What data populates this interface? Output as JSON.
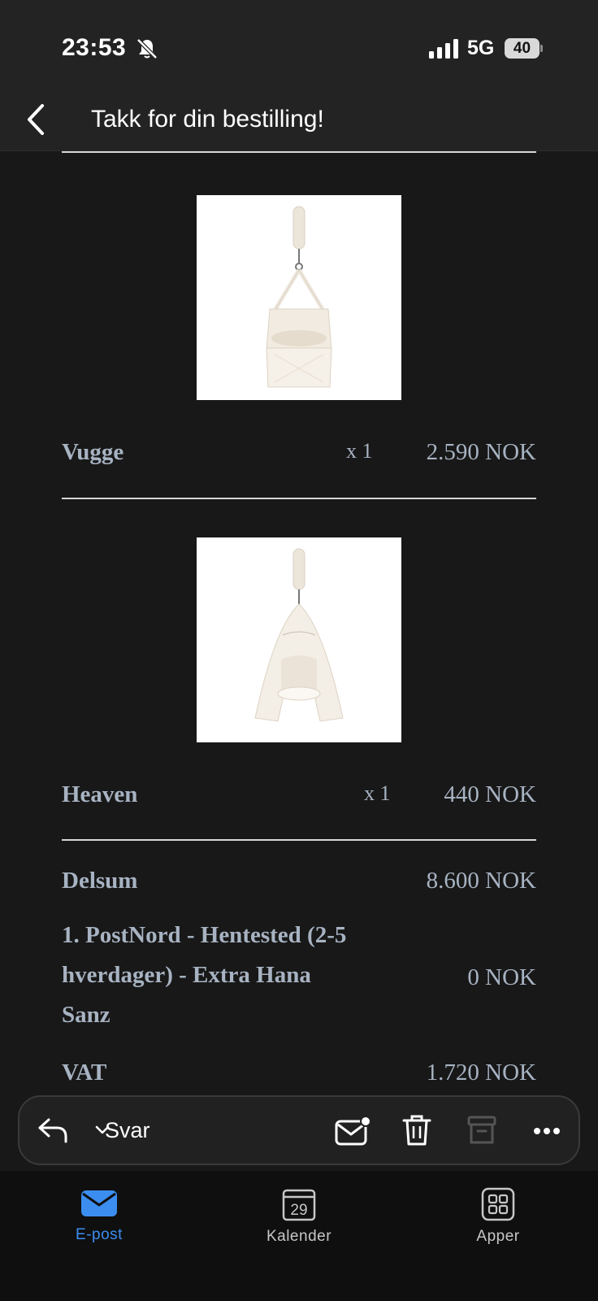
{
  "status_bar": {
    "time": "23:53",
    "network": "5G",
    "battery": "40"
  },
  "nav": {
    "title": "Takk for din bestilling!"
  },
  "products": [
    {
      "name": "Vugge",
      "qty": "x 1",
      "price": "2.590 NOK"
    },
    {
      "name": "Heaven",
      "qty": "x 1",
      "price": "440 NOK"
    }
  ],
  "summary": {
    "subtotal_label": "Delsum",
    "subtotal_value": "8.600 NOK",
    "shipping_label": "1. PostNord - Hentested (2-5 hverdager) - Extra Hana Sanz",
    "shipping_value": "0 NOK",
    "vat_label": "VAT",
    "vat_value": "1.720 NOK"
  },
  "toolbar": {
    "reply_label": "Svar"
  },
  "tabs": [
    {
      "label": "E-post",
      "active": true
    },
    {
      "label": "Kalender",
      "day": "29",
      "active": false
    },
    {
      "label": "Apper",
      "active": false
    }
  ],
  "colors": {
    "accent": "#3b8ef0",
    "text_muted": "#a7b3c2",
    "background": "#181818"
  }
}
